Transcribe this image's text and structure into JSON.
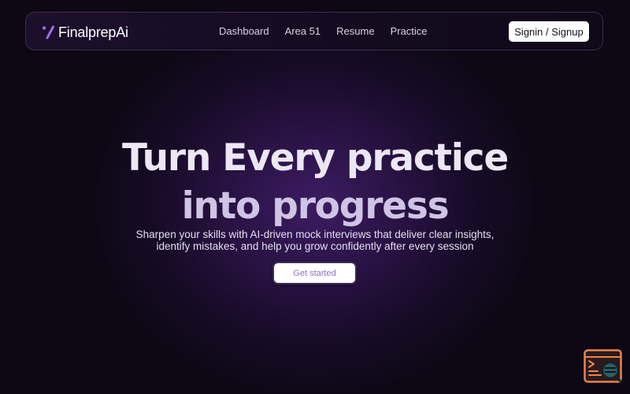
{
  "navbar": {
    "brand": "FinalprepAi",
    "links": [
      {
        "label": "Dashboard"
      },
      {
        "label": "Area 51"
      },
      {
        "label": "Resume"
      },
      {
        "label": "Practice"
      }
    ],
    "signin_label": "Signin / Signup"
  },
  "hero": {
    "title_line1": "Turn Every practice",
    "title_line2": "into progress",
    "subtitle_line1": "Sharpen your skills with AI-driven mock interviews that deliver clear insights,",
    "subtitle_line2": "identify mistakes, and help you grow confidently after every session",
    "cta_label": "Get started"
  },
  "widget": {
    "icon": "terminal-search-icon"
  },
  "colors": {
    "background": "#0d0814",
    "glow": "#3d1c63",
    "brand_accent": "#8e72c4",
    "logo_accent": "#9b6cf0",
    "widget_orange": "#e8844f",
    "widget_teal": "#2a5e66"
  }
}
